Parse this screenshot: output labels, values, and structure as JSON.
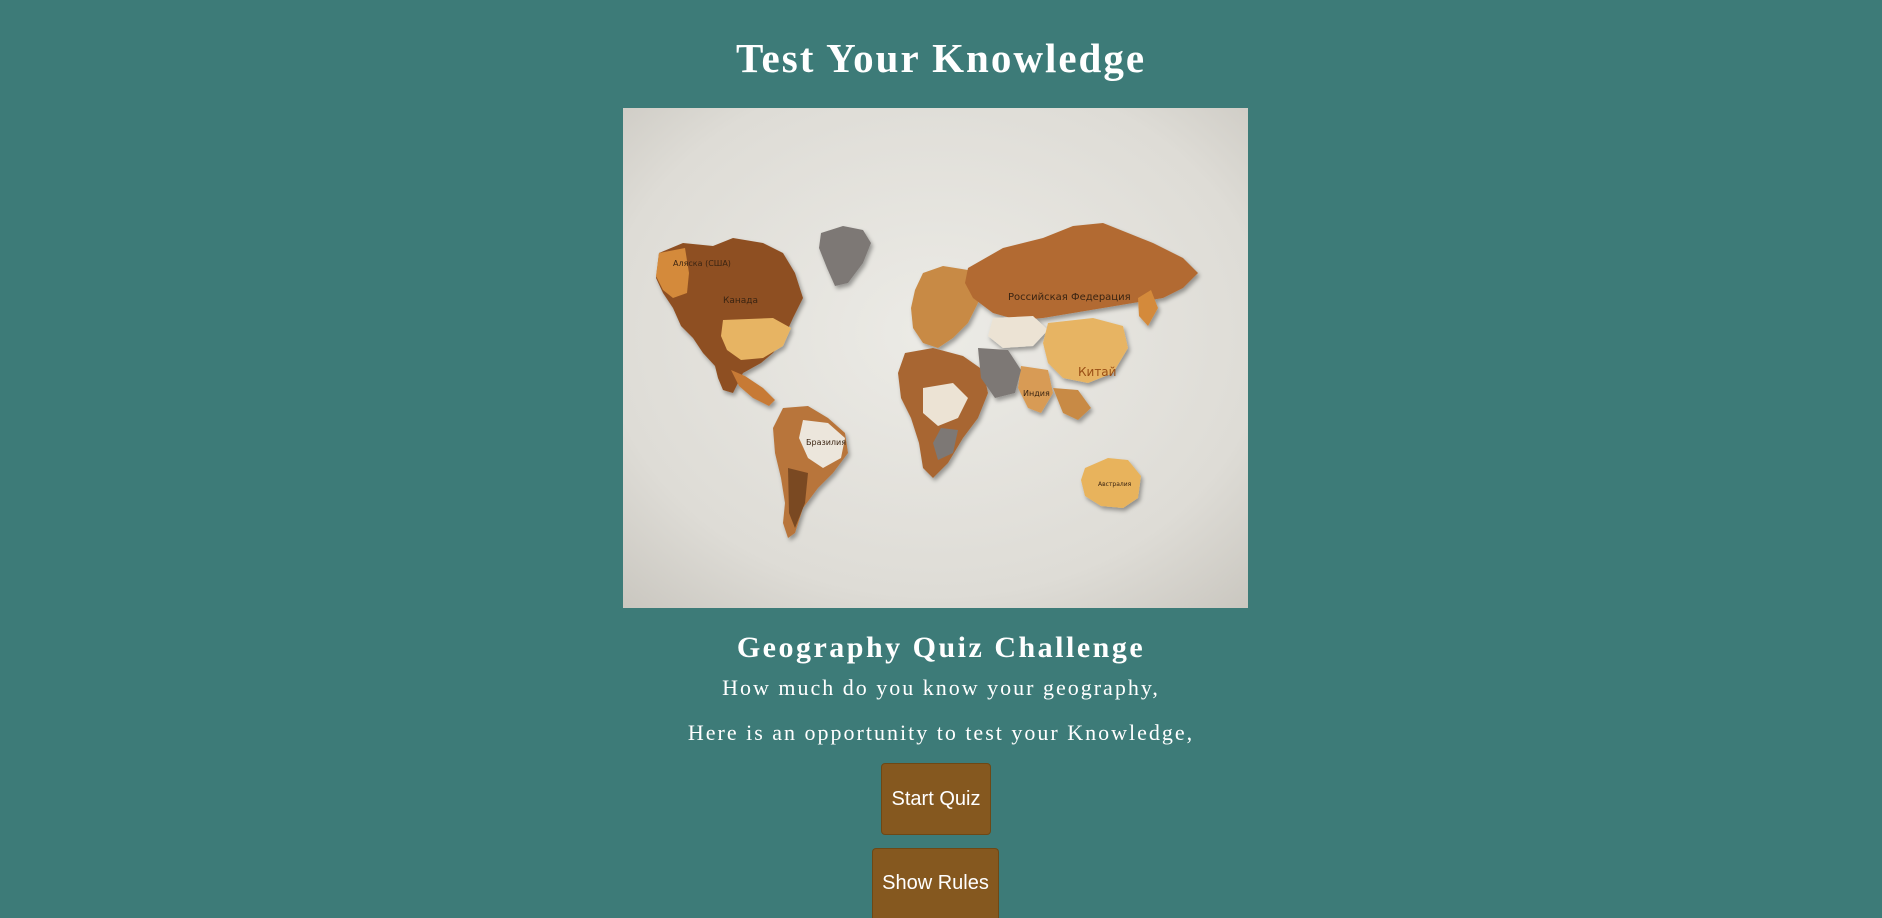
{
  "header": {
    "title": "Test Your Knowledge"
  },
  "hero": {
    "image_name": "world-map-photo",
    "map_labels": {
      "alaska": "Аляска (США)",
      "canada": "Канада",
      "russia": "Российская Федерация",
      "china": "Китай",
      "brazil": "Бразилия",
      "india": "Индия",
      "australia": "Австралия"
    }
  },
  "intro": {
    "subtitle": "Geography Quiz Challenge",
    "line1": "How much do you know your geography,",
    "line2": "Here is an opportunity to test your Knowledge,"
  },
  "actions": {
    "start_label": "Start Quiz",
    "rules_label": "Show Rules"
  },
  "colors": {
    "background": "#3d7b78",
    "button": "#85581f",
    "text": "#ffffff"
  }
}
